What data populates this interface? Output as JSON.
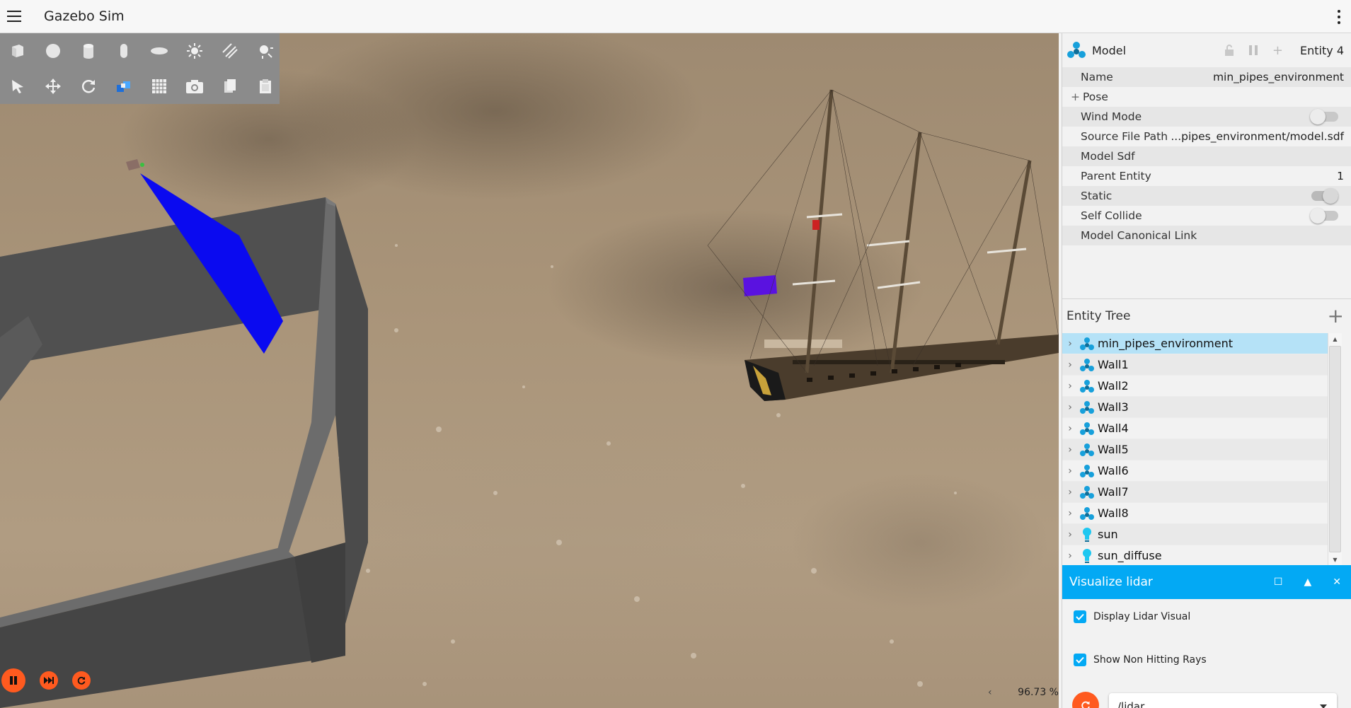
{
  "app": {
    "title": "Gazebo Sim"
  },
  "toolbar": {
    "shapes": [
      "box-icon",
      "sphere-icon",
      "cylinder-icon",
      "capsule-icon",
      "ellipsoid-icon",
      "directional-light-icon",
      "spot-light-icon",
      "point-light-icon"
    ],
    "tools": [
      "select-icon",
      "translate-icon",
      "rotate-icon",
      "snap-icon",
      "grid-icon",
      "screenshot-icon",
      "copy-icon",
      "paste-icon"
    ]
  },
  "playback": {
    "rtf_arrow": "‹",
    "rtf_value": "96.73 %"
  },
  "component_inspector": {
    "title": "Model",
    "entity_label": "Entity 4",
    "rows": {
      "name_label": "Name",
      "name_value": "min_pipes_environment",
      "pose_label": "Pose",
      "wind_mode_label": "Wind Mode",
      "source_file_label": "Source File Path",
      "source_file_value": "...pipes_environment/model.sdf",
      "model_sdf_label": "Model Sdf",
      "parent_entity_label": "Parent Entity",
      "parent_entity_value": "1",
      "static_label": "Static",
      "self_collide_label": "Self Collide",
      "canonical_link_label": "Model Canonical Link"
    },
    "toggles": {
      "wind_mode": false,
      "static": true,
      "self_collide": false
    }
  },
  "entity_tree": {
    "title": "Entity Tree",
    "items": [
      {
        "label": "min_pipes_environment",
        "icon": "model-icon",
        "selected": true
      },
      {
        "label": "Wall1",
        "icon": "model-icon"
      },
      {
        "label": "Wall2",
        "icon": "model-icon"
      },
      {
        "label": "Wall3",
        "icon": "model-icon"
      },
      {
        "label": "Wall4",
        "icon": "model-icon"
      },
      {
        "label": "Wall5",
        "icon": "model-icon"
      },
      {
        "label": "Wall6",
        "icon": "model-icon"
      },
      {
        "label": "Wall7",
        "icon": "model-icon"
      },
      {
        "label": "Wall8",
        "icon": "model-icon"
      },
      {
        "label": "sun",
        "icon": "light-icon"
      },
      {
        "label": "sun_diffuse",
        "icon": "light-icon"
      }
    ]
  },
  "lidar": {
    "title": "Visualize lidar",
    "display_label": "Display Lidar Visual",
    "display_checked": true,
    "nonhitting_label": "Show Non Hitting Rays",
    "nonhitting_checked": true,
    "topic_value": "/lidar"
  },
  "colors": {
    "accent": "#03a9f4",
    "play": "#ff5a1f",
    "selection": "#b5e2f7",
    "lidar_blue": "#0a0af0"
  }
}
